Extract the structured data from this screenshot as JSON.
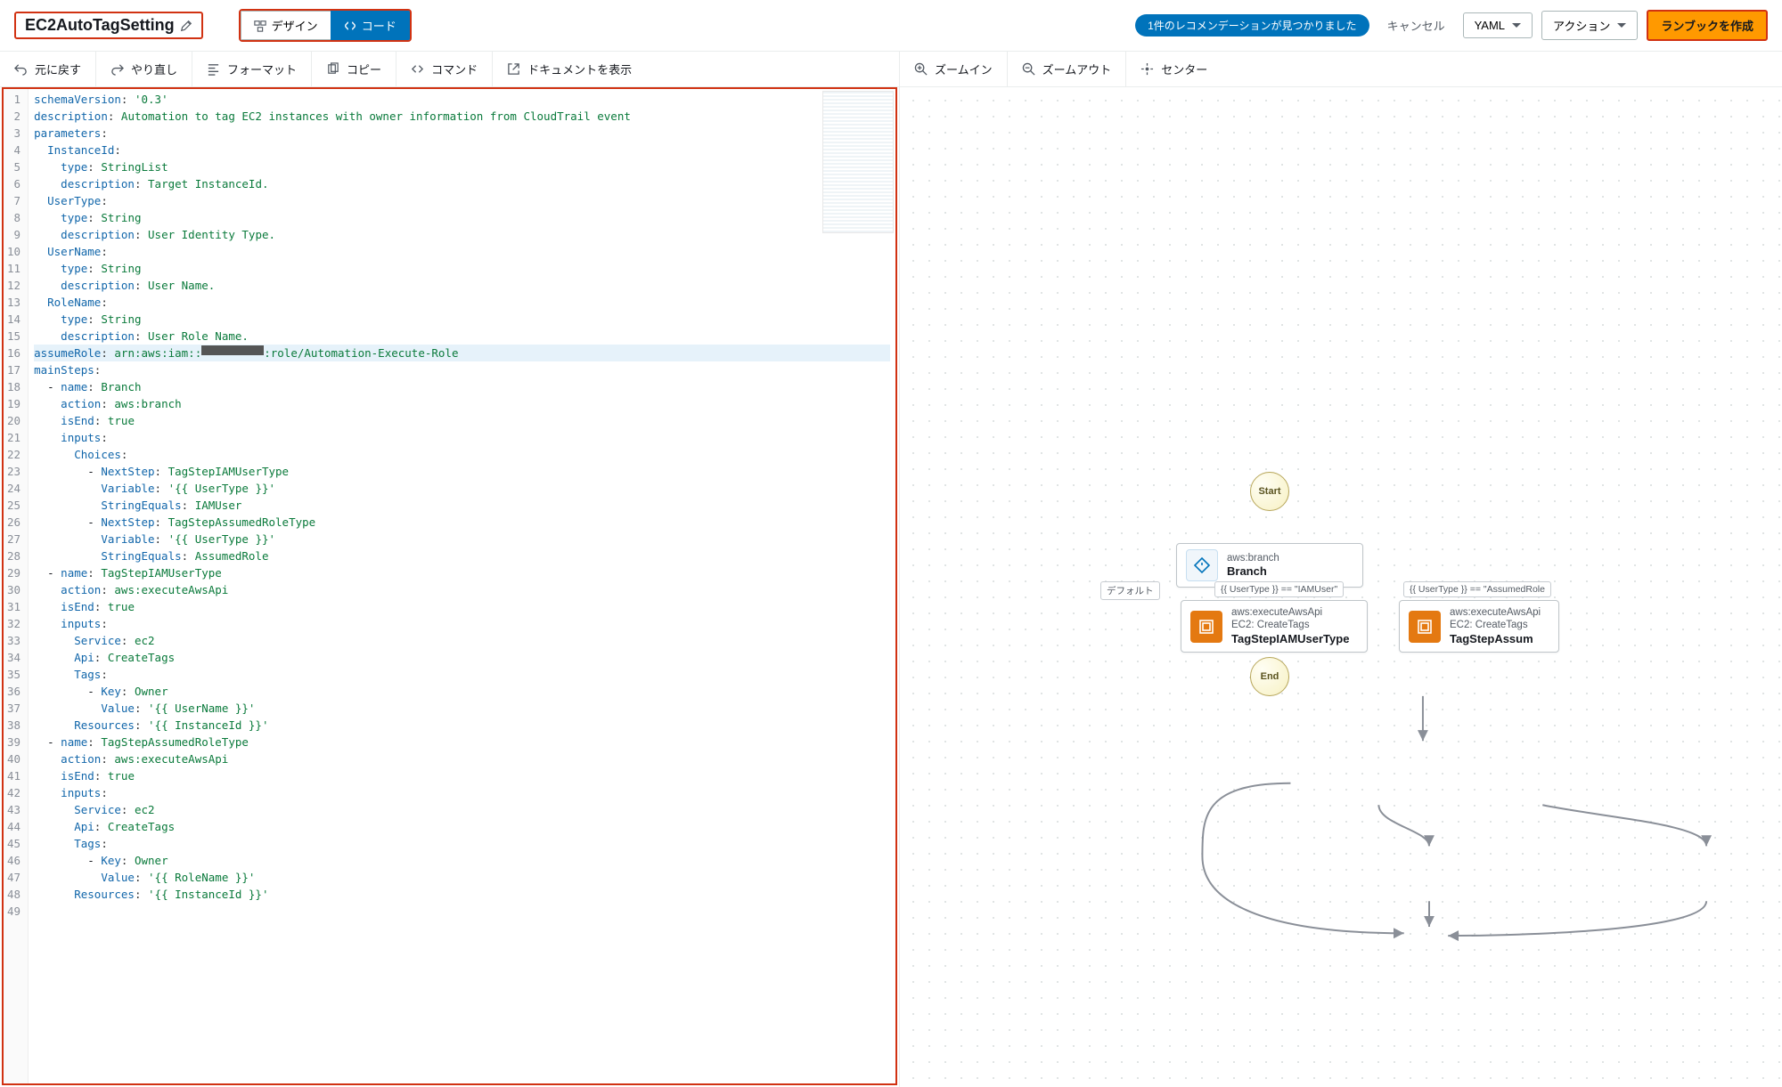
{
  "header": {
    "document_name": "EC2AutoTagSetting",
    "tabs": {
      "design": "デザイン",
      "code": "コード"
    },
    "recommendation_pill": "1件のレコメンデーションが見つかりました",
    "cancel": "キャンセル",
    "format_select": "YAML",
    "actions": "アクション",
    "create_runbook": "ランブックを作成"
  },
  "toolbar_left": {
    "undo": "元に戻す",
    "redo": "やり直し",
    "format": "フォーマット",
    "copy": "コピー",
    "command": "コマンド",
    "show_doc": "ドキュメントを表示"
  },
  "toolbar_right": {
    "zoom_in": "ズームイン",
    "zoom_out": "ズームアウト",
    "center": "センター"
  },
  "code": {
    "lines": [
      [
        [
          "key",
          "schemaVersion"
        ],
        [
          "punc",
          ": "
        ],
        [
          "str",
          "'0.3'"
        ]
      ],
      [
        [
          "key",
          "description"
        ],
        [
          "punc",
          ": "
        ],
        [
          "str",
          "Automation to tag EC2 instances with owner information from CloudTrail event"
        ]
      ],
      [
        [
          "key",
          "parameters"
        ],
        [
          "punc",
          ":"
        ]
      ],
      [
        [
          "plain",
          "  "
        ],
        [
          "key",
          "InstanceId"
        ],
        [
          "punc",
          ":"
        ]
      ],
      [
        [
          "plain",
          "    "
        ],
        [
          "key",
          "type"
        ],
        [
          "punc",
          ": "
        ],
        [
          "str",
          "StringList"
        ]
      ],
      [
        [
          "plain",
          "    "
        ],
        [
          "key",
          "description"
        ],
        [
          "punc",
          ": "
        ],
        [
          "str",
          "Target InstanceId."
        ]
      ],
      [
        [
          "plain",
          "  "
        ],
        [
          "key",
          "UserType"
        ],
        [
          "punc",
          ":"
        ]
      ],
      [
        [
          "plain",
          "    "
        ],
        [
          "key",
          "type"
        ],
        [
          "punc",
          ": "
        ],
        [
          "str",
          "String"
        ]
      ],
      [
        [
          "plain",
          "    "
        ],
        [
          "key",
          "description"
        ],
        [
          "punc",
          ": "
        ],
        [
          "str",
          "User Identity Type."
        ]
      ],
      [
        [
          "plain",
          "  "
        ],
        [
          "key",
          "UserName"
        ],
        [
          "punc",
          ":"
        ]
      ],
      [
        [
          "plain",
          "    "
        ],
        [
          "key",
          "type"
        ],
        [
          "punc",
          ": "
        ],
        [
          "str",
          "String"
        ]
      ],
      [
        [
          "plain",
          "    "
        ],
        [
          "key",
          "description"
        ],
        [
          "punc",
          ": "
        ],
        [
          "str",
          "User Name."
        ]
      ],
      [
        [
          "plain",
          "  "
        ],
        [
          "key",
          "RoleName"
        ],
        [
          "punc",
          ":"
        ]
      ],
      [
        [
          "plain",
          "    "
        ],
        [
          "key",
          "type"
        ],
        [
          "punc",
          ": "
        ],
        [
          "str",
          "String"
        ]
      ],
      [
        [
          "plain",
          "    "
        ],
        [
          "key",
          "description"
        ],
        [
          "punc",
          ": "
        ],
        [
          "str",
          "User Role Name."
        ]
      ],
      [
        [
          "key",
          "assumeRole"
        ],
        [
          "punc",
          ": "
        ],
        [
          "str",
          "arn:aws:iam::"
        ],
        [
          "redact",
          ""
        ],
        [
          "str",
          ":role/Automation-Execute-Role"
        ]
      ],
      [
        [
          "key",
          "mainSteps"
        ],
        [
          "punc",
          ":"
        ]
      ],
      [
        [
          "plain",
          "  - "
        ],
        [
          "key",
          "name"
        ],
        [
          "punc",
          ": "
        ],
        [
          "str",
          "Branch"
        ]
      ],
      [
        [
          "plain",
          "    "
        ],
        [
          "key",
          "action"
        ],
        [
          "punc",
          ": "
        ],
        [
          "str",
          "aws:branch"
        ]
      ],
      [
        [
          "plain",
          "    "
        ],
        [
          "key",
          "isEnd"
        ],
        [
          "punc",
          ": "
        ],
        [
          "bool",
          "true"
        ]
      ],
      [
        [
          "plain",
          "    "
        ],
        [
          "key",
          "inputs"
        ],
        [
          "punc",
          ":"
        ]
      ],
      [
        [
          "plain",
          "      "
        ],
        [
          "key",
          "Choices"
        ],
        [
          "punc",
          ":"
        ]
      ],
      [
        [
          "plain",
          "        - "
        ],
        [
          "key",
          "NextStep"
        ],
        [
          "punc",
          ": "
        ],
        [
          "str",
          "TagStepIAMUserType"
        ]
      ],
      [
        [
          "plain",
          "          "
        ],
        [
          "key",
          "Variable"
        ],
        [
          "punc",
          ": "
        ],
        [
          "str",
          "'{{ UserType }}'"
        ]
      ],
      [
        [
          "plain",
          "          "
        ],
        [
          "key",
          "StringEquals"
        ],
        [
          "punc",
          ": "
        ],
        [
          "str",
          "IAMUser"
        ]
      ],
      [
        [
          "plain",
          "        - "
        ],
        [
          "key",
          "NextStep"
        ],
        [
          "punc",
          ": "
        ],
        [
          "str",
          "TagStepAssumedRoleType"
        ]
      ],
      [
        [
          "plain",
          "          "
        ],
        [
          "key",
          "Variable"
        ],
        [
          "punc",
          ": "
        ],
        [
          "str",
          "'{{ UserType }}'"
        ]
      ],
      [
        [
          "plain",
          "          "
        ],
        [
          "key",
          "StringEquals"
        ],
        [
          "punc",
          ": "
        ],
        [
          "str",
          "AssumedRole"
        ]
      ],
      [
        [
          "plain",
          "  - "
        ],
        [
          "key",
          "name"
        ],
        [
          "punc",
          ": "
        ],
        [
          "str",
          "TagStepIAMUserType"
        ]
      ],
      [
        [
          "plain",
          "    "
        ],
        [
          "key",
          "action"
        ],
        [
          "punc",
          ": "
        ],
        [
          "str",
          "aws:executeAwsApi"
        ]
      ],
      [
        [
          "plain",
          "    "
        ],
        [
          "key",
          "isEnd"
        ],
        [
          "punc",
          ": "
        ],
        [
          "bool",
          "true"
        ]
      ],
      [
        [
          "plain",
          "    "
        ],
        [
          "key",
          "inputs"
        ],
        [
          "punc",
          ":"
        ]
      ],
      [
        [
          "plain",
          "      "
        ],
        [
          "key",
          "Service"
        ],
        [
          "punc",
          ": "
        ],
        [
          "str",
          "ec2"
        ]
      ],
      [
        [
          "plain",
          "      "
        ],
        [
          "key",
          "Api"
        ],
        [
          "punc",
          ": "
        ],
        [
          "str",
          "CreateTags"
        ]
      ],
      [
        [
          "plain",
          "      "
        ],
        [
          "key",
          "Tags"
        ],
        [
          "punc",
          ":"
        ]
      ],
      [
        [
          "plain",
          "        - "
        ],
        [
          "key",
          "Key"
        ],
        [
          "punc",
          ": "
        ],
        [
          "str",
          "Owner"
        ]
      ],
      [
        [
          "plain",
          "          "
        ],
        [
          "key",
          "Value"
        ],
        [
          "punc",
          ": "
        ],
        [
          "str",
          "'{{ UserName }}'"
        ]
      ],
      [
        [
          "plain",
          "      "
        ],
        [
          "key",
          "Resources"
        ],
        [
          "punc",
          ": "
        ],
        [
          "str",
          "'{{ InstanceId }}'"
        ]
      ],
      [
        [
          "plain",
          "  - "
        ],
        [
          "key",
          "name"
        ],
        [
          "punc",
          ": "
        ],
        [
          "str",
          "TagStepAssumedRoleType"
        ]
      ],
      [
        [
          "plain",
          "    "
        ],
        [
          "key",
          "action"
        ],
        [
          "punc",
          ": "
        ],
        [
          "str",
          "aws:executeAwsApi"
        ]
      ],
      [
        [
          "plain",
          "    "
        ],
        [
          "key",
          "isEnd"
        ],
        [
          "punc",
          ": "
        ],
        [
          "bool",
          "true"
        ]
      ],
      [
        [
          "plain",
          "    "
        ],
        [
          "key",
          "inputs"
        ],
        [
          "punc",
          ":"
        ]
      ],
      [
        [
          "plain",
          "      "
        ],
        [
          "key",
          "Service"
        ],
        [
          "punc",
          ": "
        ],
        [
          "str",
          "ec2"
        ]
      ],
      [
        [
          "plain",
          "      "
        ],
        [
          "key",
          "Api"
        ],
        [
          "punc",
          ": "
        ],
        [
          "str",
          "CreateTags"
        ]
      ],
      [
        [
          "plain",
          "      "
        ],
        [
          "key",
          "Tags"
        ],
        [
          "punc",
          ":"
        ]
      ],
      [
        [
          "plain",
          "        - "
        ],
        [
          "key",
          "Key"
        ],
        [
          "punc",
          ": "
        ],
        [
          "str",
          "Owner"
        ]
      ],
      [
        [
          "plain",
          "          "
        ],
        [
          "key",
          "Value"
        ],
        [
          "punc",
          ": "
        ],
        [
          "str",
          "'{{ RoleName }}'"
        ]
      ],
      [
        [
          "plain",
          "      "
        ],
        [
          "key",
          "Resources"
        ],
        [
          "punc",
          ": "
        ],
        [
          "str",
          "'{{ InstanceId }}'"
        ]
      ],
      [
        [
          "plain",
          ""
        ]
      ]
    ],
    "highlight_line": 16
  },
  "flow": {
    "start": "Start",
    "end": "End",
    "branch": {
      "action": "aws:branch",
      "name": "Branch"
    },
    "default_label": "デフォルト",
    "edge1": "{{ UserType }} == \"IAMUser\"",
    "edge2": "{{ UserType }} == \"AssumedRole",
    "step1": {
      "action": "aws:executeAwsApi",
      "api": "EC2: CreateTags",
      "name": "TagStepIAMUserType"
    },
    "step2": {
      "action": "aws:executeAwsApi",
      "api": "EC2: CreateTags",
      "name": "TagStepAssum"
    }
  }
}
